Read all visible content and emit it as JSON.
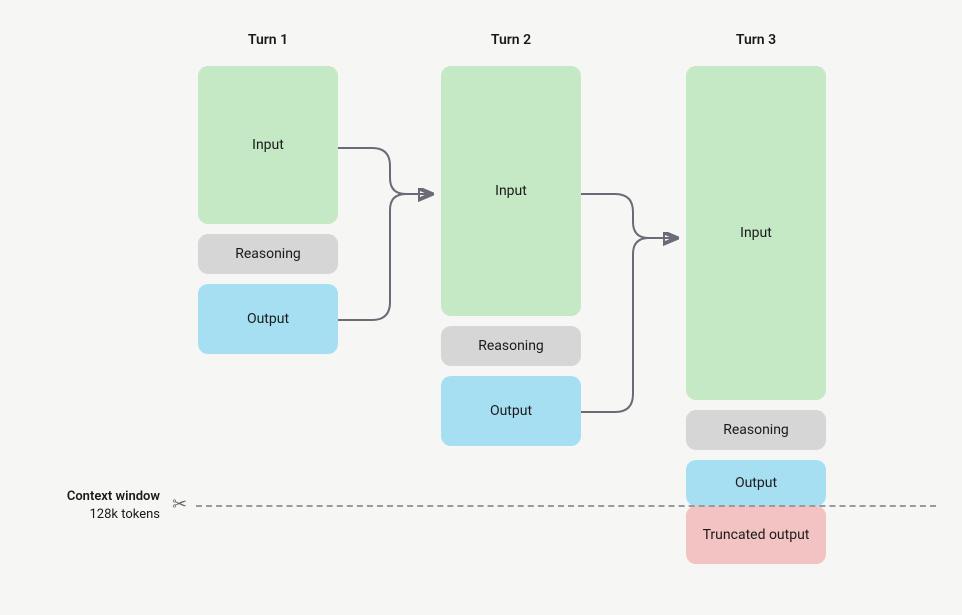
{
  "headers": {
    "turn1": "Turn 1",
    "turn2": "Turn 2",
    "turn3": "Turn 3"
  },
  "blocks": {
    "t1_input": "Input",
    "t1_reasoning": "Reasoning",
    "t1_output": "Output",
    "t2_input": "Input",
    "t2_reasoning": "Reasoning",
    "t2_output": "Output",
    "t3_input": "Input",
    "t3_reasoning": "Reasoning",
    "t3_output": "Output",
    "t3_truncated": "Truncated output"
  },
  "context_window": {
    "label_line1": "Context window",
    "label_line2": "128k tokens",
    "scissors_glyph": "✂"
  },
  "colors": {
    "input": "#c5e8c5",
    "reasoning": "#d6d6d6",
    "output": "#a7dff2",
    "truncated": "#f3c2c2",
    "arrow": "#6b6b78",
    "dashed": "#9a9a9a"
  }
}
